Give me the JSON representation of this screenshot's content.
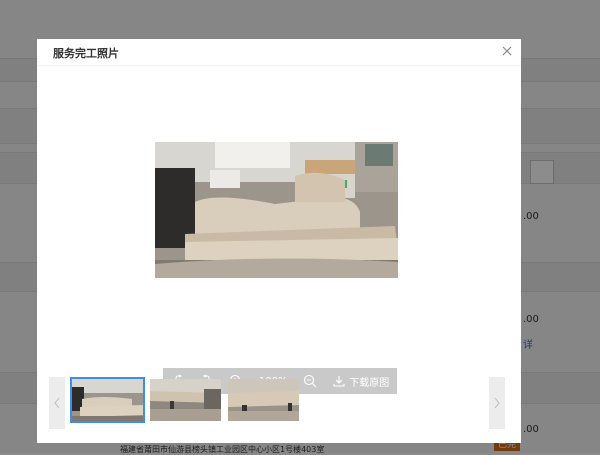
{
  "background": {
    "price_1": ".00",
    "price_2": ".00",
    "price_3": ".00",
    "link_text": "详",
    "address": "福建省莆田市仙游县榜头镇工业园区中心小区1号楼403室",
    "badge": "已完"
  },
  "modal": {
    "title": "服务完工照片",
    "close_icon": "close-icon"
  },
  "toolbar": {
    "zoom_level": "100%",
    "download_label": "下载原图",
    "icons": [
      "rotate-right-icon",
      "rotate-left-icon",
      "zoom-in-icon",
      "zoom-out-icon",
      "download-icon"
    ]
  },
  "thumbnails": {
    "count": 3,
    "active_index": 0,
    "prev_icon": "chevron-left-icon",
    "next_icon": "chevron-right-icon"
  },
  "colors": {
    "accent": "#3d8ee6",
    "toolbar_bg": "#c9c9c9",
    "badge": "#d46a1a"
  }
}
